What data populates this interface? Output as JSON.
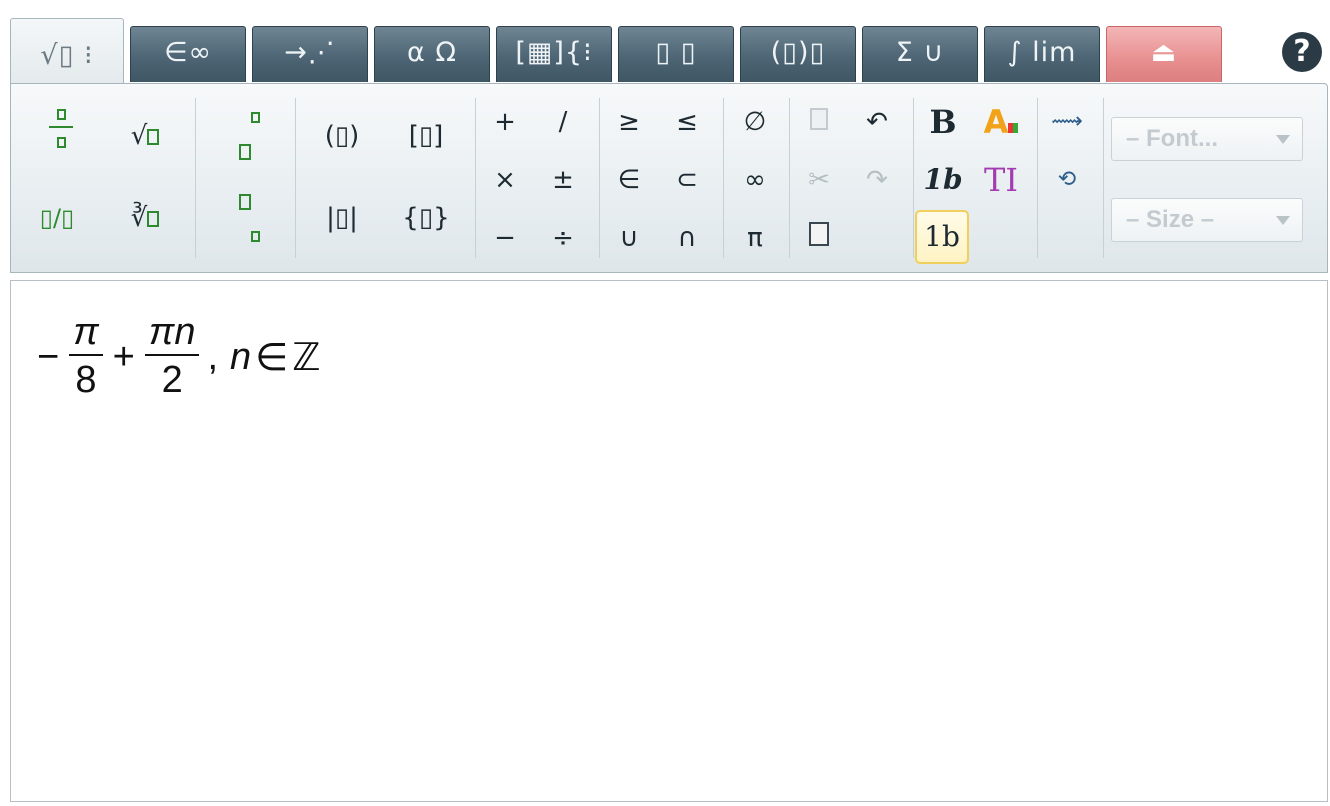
{
  "tabs": [
    {
      "id": "basic",
      "label": "√▯ ⁝",
      "active": true
    },
    {
      "id": "symbols",
      "label": "∈∞"
    },
    {
      "id": "arrows",
      "label": "→⋰"
    },
    {
      "id": "greek",
      "label": "α Ω"
    },
    {
      "id": "matrices",
      "label": "[▦]{⁝"
    },
    {
      "id": "scripts",
      "label": "▯ ▯"
    },
    {
      "id": "brackets",
      "label": "(▯)▯"
    },
    {
      "id": "bigops",
      "label": "Σ ∪"
    },
    {
      "id": "calculus",
      "label": "∫ lim"
    },
    {
      "id": "insert",
      "label": "⏏",
      "color": "#e88f90"
    }
  ],
  "help": {
    "label": "?"
  },
  "toolbar": {
    "fraction": "▯/▯",
    "sqrt": "√",
    "nroot": "∛",
    "abs": "|▯|",
    "paren": "(▯)",
    "bracket": "[▯]",
    "brace": "{▯}",
    "ops": {
      "plus": "+",
      "slash": "/",
      "times": "×",
      "plusminus": "±",
      "minus": "−",
      "divide": "÷",
      "geq": "≥",
      "leq": "≤",
      "in": "∈",
      "subset": "⊂",
      "cup": "∪",
      "cap": "∩",
      "emptyset": "∅",
      "infinity": "∞",
      "pi": "π"
    },
    "undo": "↶",
    "redo": "↷",
    "bold": "B",
    "italic_num": "1b",
    "normal_num": "1b",
    "text_mode": "TI",
    "font_select": "– Font...",
    "size_select": "– Size –"
  },
  "editor": {
    "expression": {
      "lead_sign": "−",
      "frac1_num": "π",
      "frac1_den": "8",
      "plus": "+",
      "frac2_num": "πn",
      "frac2_den": "2",
      "tail": ",",
      "var": "n",
      "in": "∈",
      "set": "ℤ"
    }
  }
}
